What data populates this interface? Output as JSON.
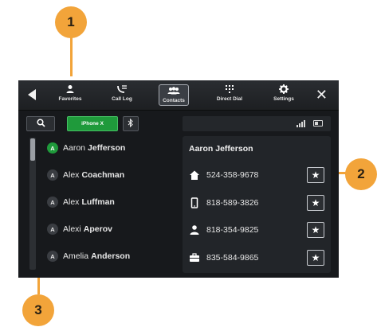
{
  "callouts": [
    "1",
    "2",
    "3"
  ],
  "nav": {
    "tabs": [
      {
        "label": "Favorites",
        "icon": "person-star-icon"
      },
      {
        "label": "Call Log",
        "icon": "call-log-icon"
      },
      {
        "label": "Contacts",
        "icon": "contacts-icon",
        "active": true
      },
      {
        "label": "Direct Dial",
        "icon": "dialpad-icon"
      },
      {
        "label": "Settings",
        "icon": "gear-icon"
      }
    ]
  },
  "toolbar": {
    "phone_label": "iPhone X"
  },
  "contacts": [
    {
      "letter": "A",
      "first": "Aaron",
      "last": "Jefferson",
      "selected": true
    },
    {
      "letter": "A",
      "first": "Alex",
      "last": "Coachman"
    },
    {
      "letter": "A",
      "first": "Alex",
      "last": "Luffman"
    },
    {
      "letter": "A",
      "first": "Alexi",
      "last": "Aperov"
    },
    {
      "letter": "A",
      "first": "Amelia",
      "last": "Anderson"
    }
  ],
  "detail": {
    "name": "Aaron Jefferson",
    "numbers": [
      {
        "type": "home",
        "icon": "home-icon",
        "number": "524-358-9678"
      },
      {
        "type": "mobile",
        "icon": "mobile-icon",
        "number": "818-589-3826"
      },
      {
        "type": "personal",
        "icon": "person-icon",
        "number": "818-354-9825"
      },
      {
        "type": "work",
        "icon": "briefcase-icon",
        "number": "835-584-9865"
      }
    ]
  },
  "colors": {
    "accent_callout": "#f2a43a",
    "active_green": "#1f9a3b",
    "screen_bg": "#17191c"
  }
}
